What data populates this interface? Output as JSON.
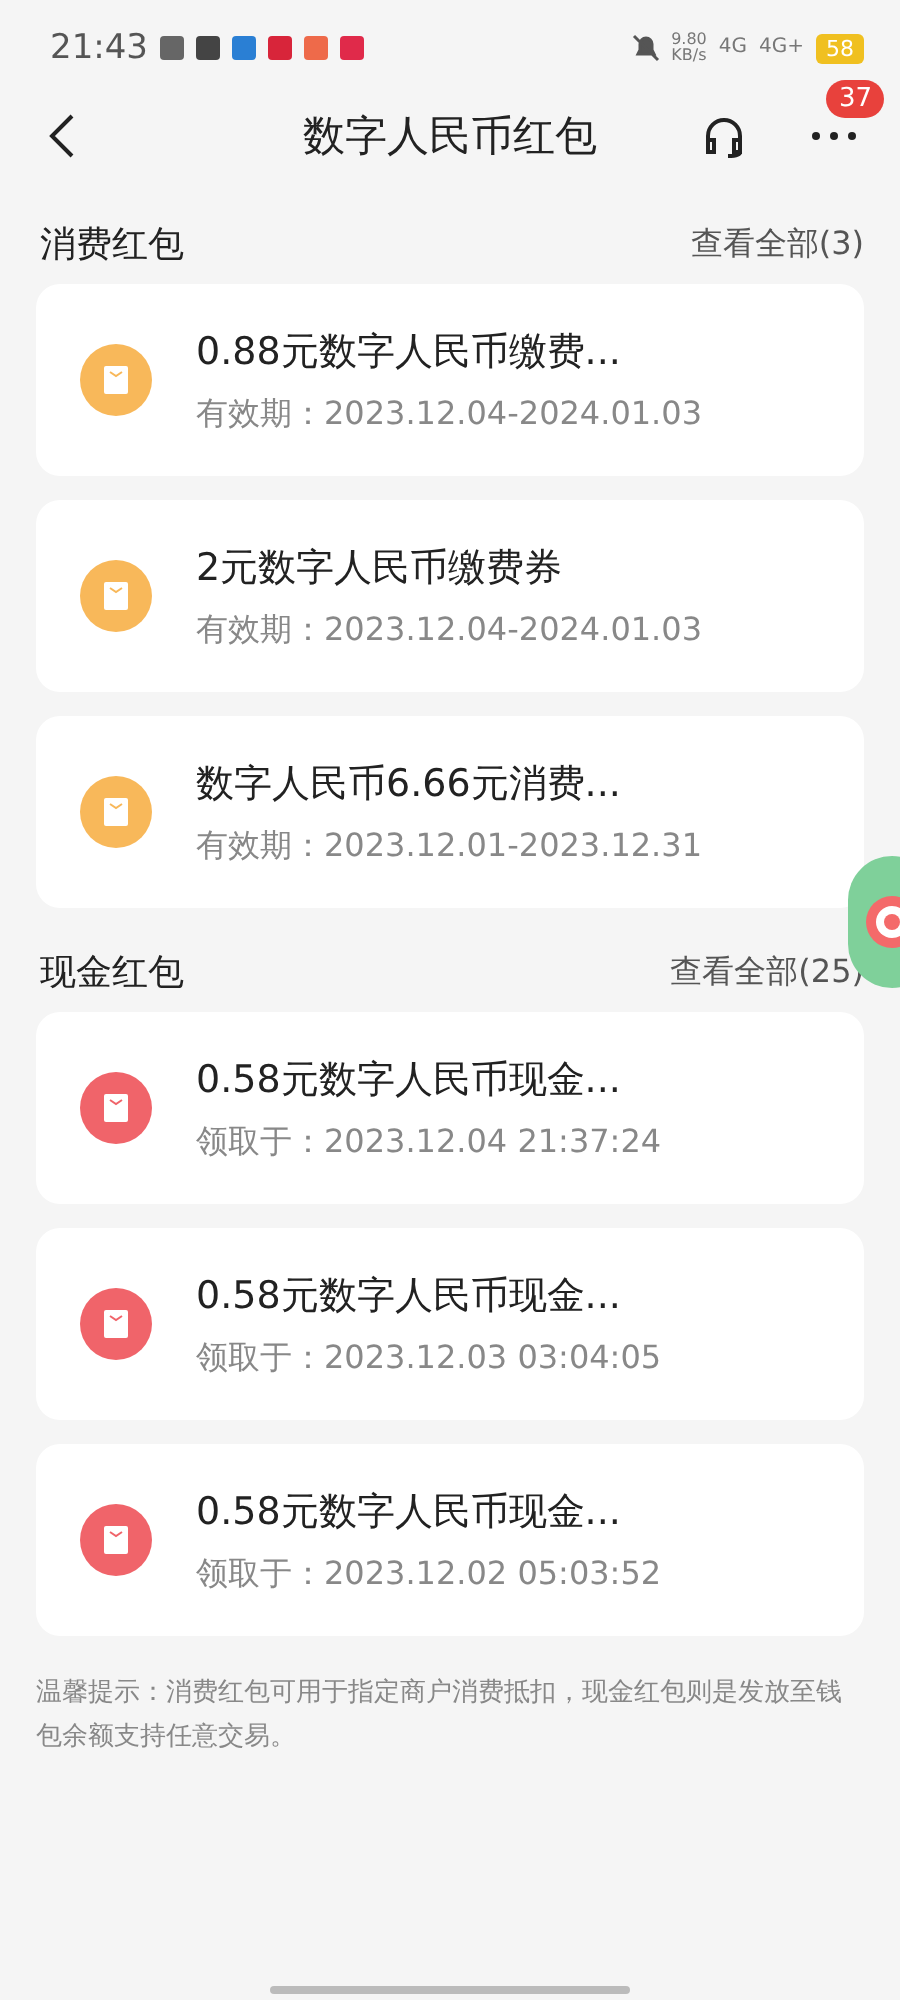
{
  "status_bar": {
    "time": "21:43",
    "speed": "9.80",
    "speed_unit": "KB/s",
    "network_1": "4G",
    "network_2": "4G+",
    "battery": "58"
  },
  "header": {
    "title": "数字人民币红包",
    "badge": "37"
  },
  "sections": [
    {
      "kind": "consume",
      "title": "消费红包",
      "view_all": "查看全部(3)",
      "items": [
        {
          "title": "0.88元数字人民币缴费...",
          "label": "有效期：",
          "date": "2023.12.04-2024.01.03"
        },
        {
          "title": "2元数字人民币缴费券",
          "label": "有效期：",
          "date": "2023.12.04-2024.01.03"
        },
        {
          "title": "数字人民币6.66元消费...",
          "label": "有效期：",
          "date": "2023.12.01-2023.12.31"
        }
      ]
    },
    {
      "kind": "cash",
      "title": "现金红包",
      "view_all": "查看全部(25)",
      "items": [
        {
          "title": "0.58元数字人民币现金...",
          "label": "领取于：",
          "date": "2023.12.04 21:37:24"
        },
        {
          "title": "0.58元数字人民币现金...",
          "label": "领取于：",
          "date": "2023.12.03 03:04:05"
        },
        {
          "title": "0.58元数字人民币现金...",
          "label": "领取于：",
          "date": "2023.12.02 05:03:52"
        }
      ]
    }
  ],
  "note": "温馨提示：消费红包可用于指定商户消费抵扣，现金红包则是发放至钱包余额支持任意交易。"
}
